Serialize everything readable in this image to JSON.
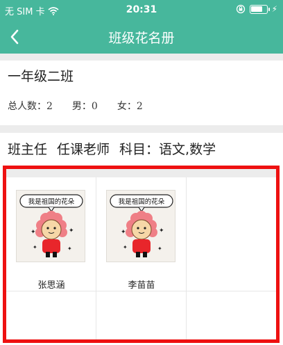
{
  "status": {
    "carrier": "无 SIM 卡",
    "time": "20:31"
  },
  "nav": {
    "title": "班级花名册"
  },
  "class_info": {
    "name": "一年级二班",
    "total_label": "总人数：2",
    "male_label": "男：0",
    "female_label": "女：2"
  },
  "teacher_row": {
    "head_teacher": "班主任",
    "subject_teacher": "任课老师",
    "subjects_label": "科目：语文,数学"
  },
  "students": [
    {
      "name": "张思涵",
      "avatar_caption": "我是祖国的花朵"
    },
    {
      "name": "李苗苗",
      "avatar_caption": "我是祖国的花朵"
    }
  ],
  "colors": {
    "header": "#47b79c",
    "highlight": "#ee1111",
    "separator": "#ececec"
  },
  "icons": [
    "back-arrow-icon",
    "wifi-icon",
    "lock-rotation-icon",
    "battery-icon"
  ]
}
